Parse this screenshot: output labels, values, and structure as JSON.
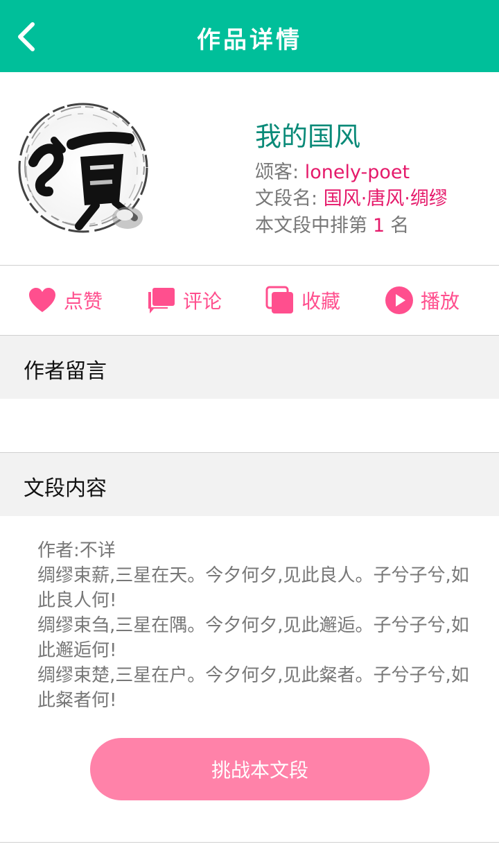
{
  "header": {
    "title": "作品详情",
    "back_icon": "chevron-left-icon",
    "bg_color": "#00bf9a"
  },
  "work": {
    "cover_icon": "ink-calligraphy-seal-image",
    "title": "我的国风",
    "poet_label": "颂客:",
    "poet_name": "lonely-poet",
    "segment_label": "文段名:",
    "segment_name": "国风·唐风·绸缪",
    "rank_prefix": "本文段中排第",
    "rank_value": "1",
    "rank_suffix": "名"
  },
  "actions": [
    {
      "label": "点赞",
      "icon": "heart-icon"
    },
    {
      "label": "评论",
      "icon": "comment-icon"
    },
    {
      "label": "收藏",
      "icon": "collection-icon"
    },
    {
      "label": "播放",
      "icon": "play-icon"
    }
  ],
  "sections": {
    "author_message": {
      "title": "作者留言",
      "content": ""
    },
    "segment_content": {
      "title": "文段内容"
    }
  },
  "lyrics": [
    "作者:不详",
    "绸缪束薪,三星在天。今夕何夕,见此良人。子兮子兮,如此良人何!",
    "绸缪束刍,三星在隅。今夕何夕,见此邂逅。子兮子兮,如此邂逅何!",
    "绸缪束楚,三星在户。今夕何夕,见此粲者。子兮子兮,如此粲者何!"
  ],
  "challenge_button": {
    "label": "挑战本文段",
    "color": "#ff82a9"
  },
  "colors": {
    "accent": "#e5196a",
    "action": "#ff4f8e",
    "title": "#0a8a78"
  }
}
